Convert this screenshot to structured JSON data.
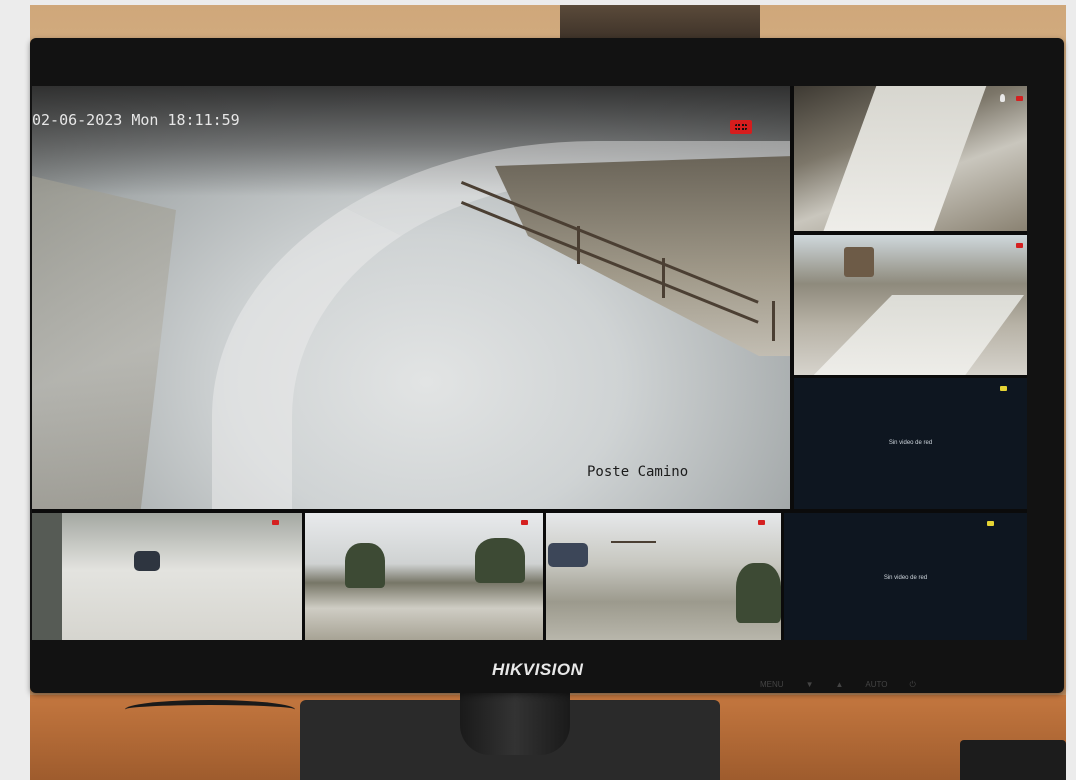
{
  "main_camera": {
    "osd_datetime": "02-06-2023 Mon 18:11:59",
    "camera_name": "Poste Camino",
    "record_icon": "record-camera-icon",
    "record_color": "#d51d1d"
  },
  "tiles": {
    "no_video_text": "Sin video de red"
  },
  "monitor": {
    "brand": "HIKVISION",
    "buttons": [
      "MENU",
      "▼",
      "▲",
      "AUTO",
      "⏻"
    ]
  },
  "colors": {
    "alert_red": "#d52020",
    "alert_yellow": "#e6d434",
    "bezel": "#121212"
  }
}
